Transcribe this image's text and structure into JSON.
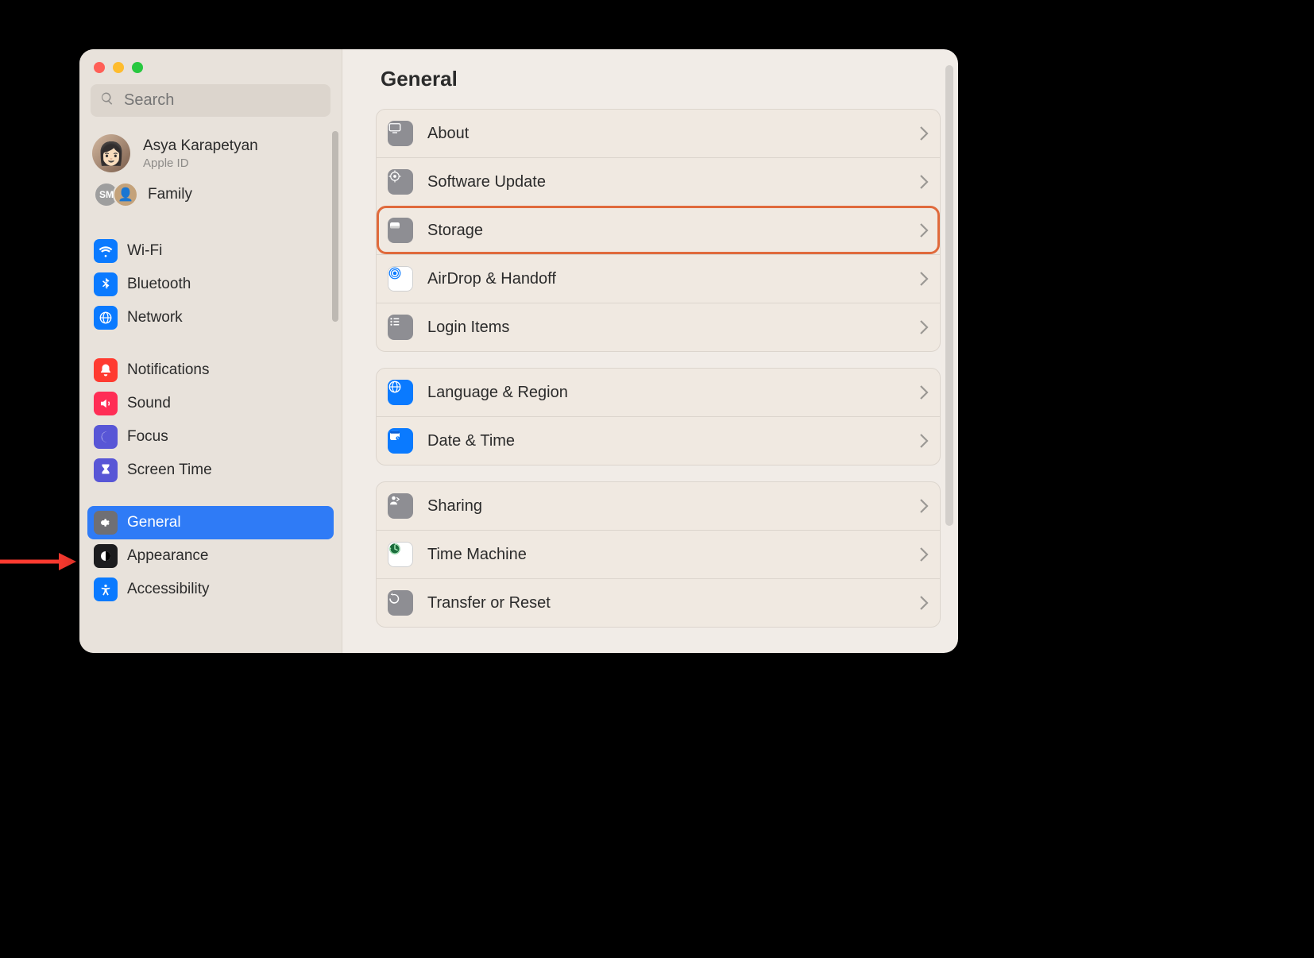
{
  "annotation": {
    "target": "sidebar-item-general"
  },
  "window": {
    "title": "General",
    "search": {
      "placeholder": "Search"
    },
    "account": {
      "name": "Asya Karapetyan",
      "subtitle": "Apple ID"
    },
    "family": {
      "badge": "SM",
      "label": "Family"
    }
  },
  "sidebar": {
    "groups": [
      [
        {
          "id": "wifi",
          "label": "Wi-Fi",
          "icon": "wifi-icon",
          "color": "blue"
        },
        {
          "id": "bluetooth",
          "label": "Bluetooth",
          "icon": "bluetooth-icon",
          "color": "blue"
        },
        {
          "id": "network",
          "label": "Network",
          "icon": "globe-icon",
          "color": "blue"
        }
      ],
      [
        {
          "id": "notifications",
          "label": "Notifications",
          "icon": "bell-icon",
          "color": "red"
        },
        {
          "id": "sound",
          "label": "Sound",
          "icon": "speaker-icon",
          "color": "redpink"
        },
        {
          "id": "focus",
          "label": "Focus",
          "icon": "moon-icon",
          "color": "indigo"
        },
        {
          "id": "screentime",
          "label": "Screen Time",
          "icon": "hourglass-icon",
          "color": "indigo"
        }
      ],
      [
        {
          "id": "general",
          "label": "General",
          "icon": "gear-icon",
          "color": "gray",
          "selected": true
        },
        {
          "id": "appearance",
          "label": "Appearance",
          "icon": "appearance-icon",
          "color": "black"
        },
        {
          "id": "accessibility",
          "label": "Accessibility",
          "icon": "accessibility-icon",
          "color": "blue"
        }
      ]
    ]
  },
  "content": {
    "panels": [
      [
        {
          "id": "about",
          "label": "About",
          "icon": "display-icon",
          "color": "gray"
        },
        {
          "id": "software-update",
          "label": "Software Update",
          "icon": "gear-badge-icon",
          "color": "gray"
        },
        {
          "id": "storage",
          "label": "Storage",
          "icon": "disk-icon",
          "color": "gray",
          "highlighted": true
        },
        {
          "id": "airdrop-handoff",
          "label": "AirDrop & Handoff",
          "icon": "airdrop-icon",
          "color": "white-bg"
        },
        {
          "id": "login-items",
          "label": "Login Items",
          "icon": "list-icon",
          "color": "gray"
        }
      ],
      [
        {
          "id": "language-region",
          "label": "Language & Region",
          "icon": "globe-icon",
          "color": "blue"
        },
        {
          "id": "date-time",
          "label": "Date & Time",
          "icon": "calendar-icon",
          "color": "blue"
        }
      ],
      [
        {
          "id": "sharing",
          "label": "Sharing",
          "icon": "person-arrow-icon",
          "color": "gray"
        },
        {
          "id": "time-machine",
          "label": "Time Machine",
          "icon": "timemachine-icon",
          "color": "tm"
        },
        {
          "id": "transfer-reset",
          "label": "Transfer or Reset",
          "icon": "undo-icon",
          "color": "gray"
        }
      ]
    ]
  }
}
